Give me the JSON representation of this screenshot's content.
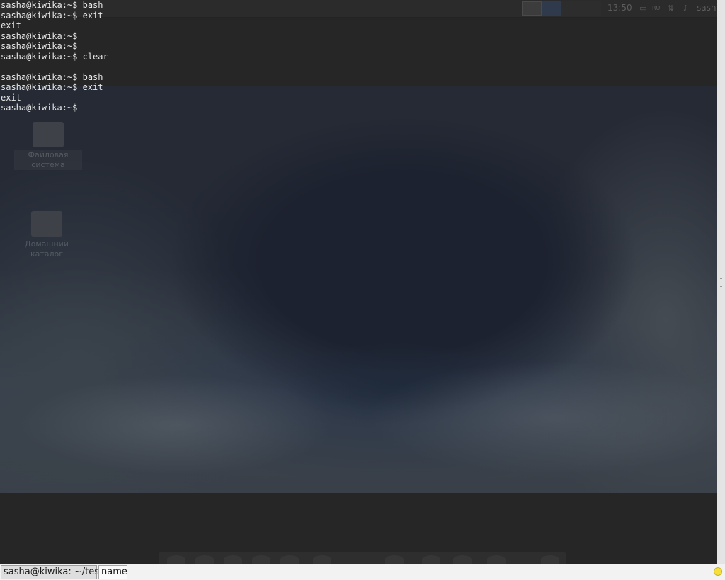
{
  "top_panel": {
    "clock": "13:50",
    "keyboard_layout": "RU",
    "user": "sash",
    "pager_icon": "window-icon",
    "tray_icons": [
      "battery-icon",
      "network-icon",
      "volume-icon"
    ]
  },
  "desktop": {
    "icons": [
      {
        "label": "Файловая система",
        "icon": "drive-icon"
      },
      {
        "label": "Домашний каталог",
        "icon": "home-folder-icon"
      }
    ]
  },
  "terminal": {
    "lines": [
      "sasha@kiwika:~$ bash",
      "sasha@kiwika:~$ exit",
      "exit",
      "sasha@kiwika:~$",
      "sasha@kiwika:~$",
      "sasha@kiwika:~$ clear",
      "",
      "sasha@kiwika:~$ bash",
      "sasha@kiwika:~$ exit",
      "exit",
      "sasha@kiwika:~$"
    ]
  },
  "taskbar": {
    "tasks": [
      {
        "label": "sasha@kiwika: ~/test"
      },
      {
        "label": "name"
      }
    ],
    "tray_icon": "smiley-icon"
  },
  "colors": {
    "terminal_text": "#e6e6e6",
    "terminal_background": "#242424",
    "taskbar_background": "#f2f2f2",
    "scrollbar_background": "#e4e4e4"
  }
}
